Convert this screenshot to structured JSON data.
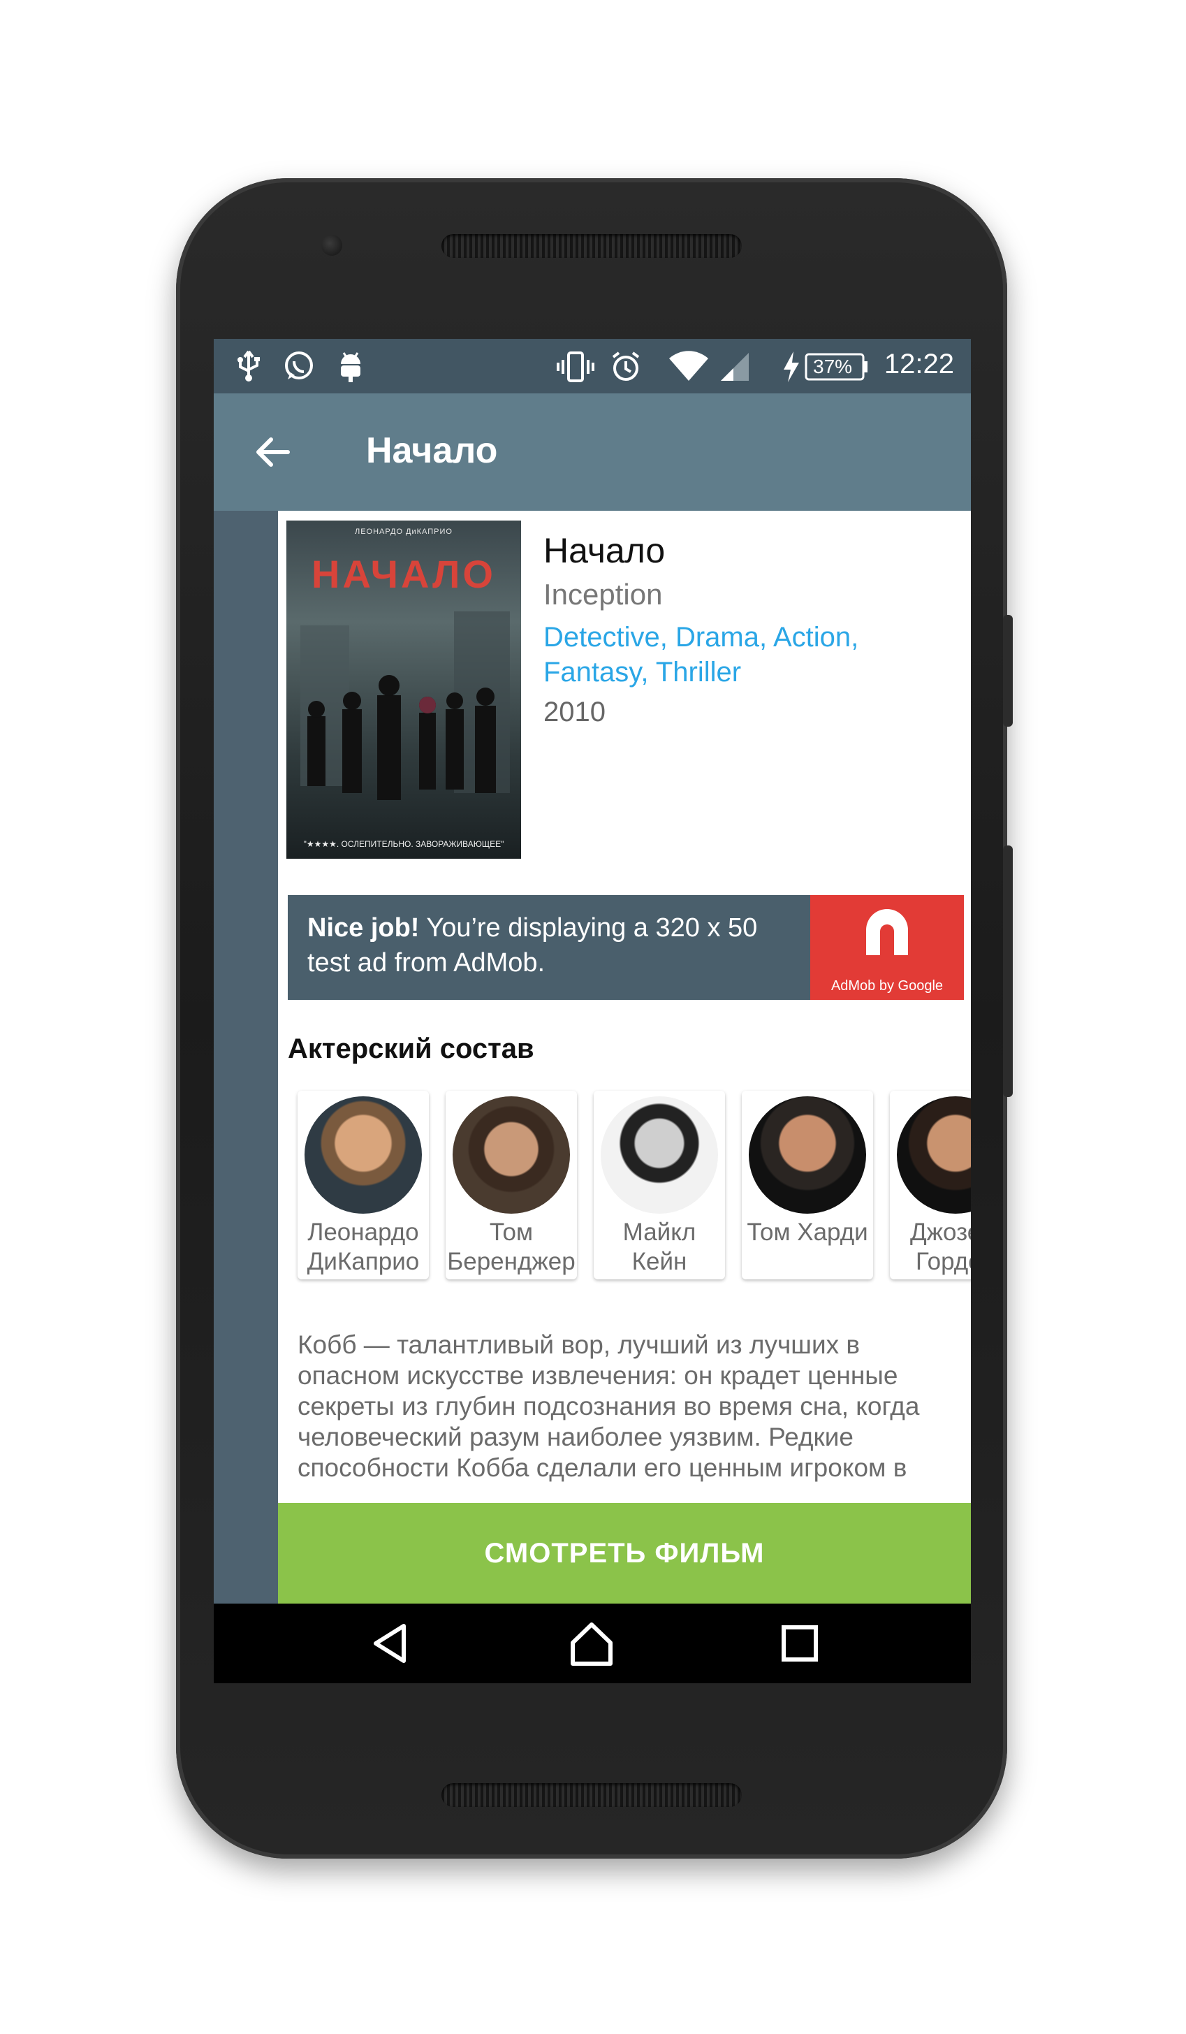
{
  "status_bar": {
    "time": "12:22",
    "battery_percent": "37%",
    "icons": [
      "usb-icon",
      "whatsapp-icon",
      "android-debug-icon",
      "vibrate-icon",
      "alarm-icon",
      "wifi-icon",
      "signal-icon",
      "charging-icon",
      "battery-icon"
    ]
  },
  "app_bar": {
    "title": "Начало",
    "back_icon": "arrow-back-icon"
  },
  "movie": {
    "poster": {
      "top_text": "ЛЕОНАРДО ДиКАПРИО",
      "title": "НАЧАЛО",
      "quote": "\"★★★★. ОСЛЕПИТЕЛЬНО. ЗАВОРАЖИВАЮЩЕЕ\""
    },
    "title": "Начало",
    "original_title": "Inception",
    "genres": "Detective, Drama, Action, Fantasy, Thriller",
    "year": "2010"
  },
  "ad": {
    "bold": "Nice job!",
    "text": " You’re displaying a 320 x 50 test ad from AdMob.",
    "logo_caption": "AdMob by Google"
  },
  "cast": {
    "heading": "Актерский состав",
    "members": [
      {
        "name": "Леонардо\nДиКаприо"
      },
      {
        "name": "Том\nБеренджер"
      },
      {
        "name": "Майкл\nКейн"
      },
      {
        "name": "Том Харди"
      },
      {
        "name": "Джозеф\nГордон"
      }
    ]
  },
  "description": "Кобб — талантливый вор, лучший из лучших в опасном искусстве извлечения: он крадет ценные секреты из глубин подсознания во время сна, когда человеческий разум наиболее уязвим. Редкие способности Кобба сделали его ценным игроком в",
  "watch_button": "СМОТРЕТЬ ФИЛЬМ",
  "nav_bar": {
    "icons": [
      "back-triangle-icon",
      "home-icon",
      "recents-square-icon"
    ]
  },
  "colors": {
    "status_bar": "#425663",
    "app_bar": "#607d8b",
    "accent_blue": "#2aa6e6",
    "watch_button": "#8bc34a",
    "ad_logo": "#e23b36"
  }
}
